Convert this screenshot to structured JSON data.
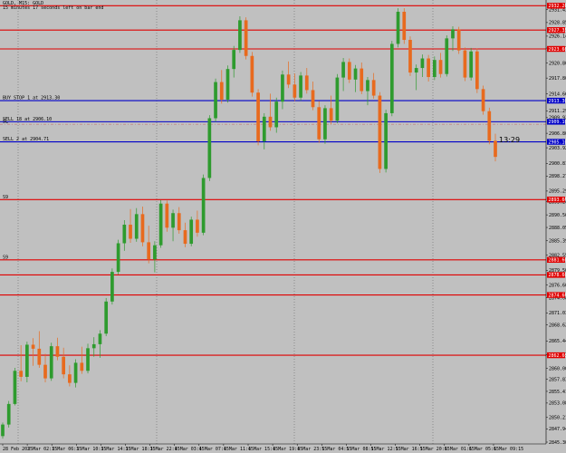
{
  "header": {
    "symbol_line": "GOLD, M15: GOLD",
    "info_line": "15 minutes 17 seconds left on bar end"
  },
  "timer": "13:29",
  "chart_data": {
    "type": "candlestick",
    "symbol": "GOLD",
    "timeframe": "M15",
    "ylim": [
      2845.3,
      2932.8
    ],
    "price_ticks": [
      "2931.43",
      "2928.85",
      "2926.14",
      "2923.77",
      "2920.80",
      "2917.80",
      "2914.66",
      "2911.29",
      "2909.92",
      "2906.80",
      "2903.92",
      "2900.81",
      "2898.27",
      "2895.29",
      "2893.20",
      "2890.56",
      "2888.05",
      "2885.39",
      "2882.55",
      "2879.50",
      "2876.60",
      "2874.08",
      "2871.03",
      "2868.62",
      "2865.44",
      "2862.73",
      "2860.00",
      "2857.83",
      "2855.41",
      "2853.08",
      "2850.21",
      "2847.94",
      "2845.30"
    ],
    "time_ticks": [
      "28 Feb 2025",
      "3 Mar 02:15",
      "3 Mar 06:15",
      "3 Mar 10:15",
      "3 Mar 14:15",
      "3 Mar 18:15",
      "3 Mar 22:15",
      "4 Mar 03:15",
      "4 Mar 07:15",
      "4 Mar 11:15",
      "4 Mar 15:15",
      "4 Mar 19:15",
      "4 Mar 23:15",
      "5 Mar 04:15",
      "5 Mar 08:15",
      "5 Mar 12:15",
      "5 Mar 16:15",
      "5 Mar 20:15",
      "6 Mar 01:15",
      "6 Mar 05:15",
      "6 Mar 09:15"
    ],
    "levels": [
      {
        "price": 2932.2,
        "kind": "red",
        "axis_label": "2932.20",
        "chart_label": ""
      },
      {
        "price": 2927.35,
        "kind": "red",
        "axis_label": "2927.35",
        "chart_label": ""
      },
      {
        "price": 2923.6,
        "kind": "red",
        "axis_label": "2923.60",
        "chart_label": ""
      },
      {
        "price": 2913.3,
        "kind": "blue",
        "axis_label": "2913.30",
        "chart_label": "BUY STOP 1 at 2913.30"
      },
      {
        "price": 2909.1,
        "kind": "blue",
        "axis_label": "2909.10",
        "chart_label": "SELL 18 at 2906.10"
      },
      {
        "price": 2908.6,
        "kind": "dash",
        "axis_label": "",
        "chart_label": "SL"
      },
      {
        "price": 2905.1,
        "kind": "blue",
        "axis_label": "2905.10",
        "chart_label": "SELL 2 at 2904.71"
      },
      {
        "price": 2893.6,
        "kind": "red",
        "axis_label": "2893.60",
        "chart_label": "S9"
      },
      {
        "price": 2881.6,
        "kind": "red",
        "axis_label": "2881.60",
        "chart_label": "S9"
      },
      {
        "price": 2878.6,
        "kind": "red",
        "axis_label": "2878.60",
        "chart_label": ""
      },
      {
        "price": 2874.6,
        "kind": "red",
        "axis_label": "2874.60",
        "chart_label": ""
      },
      {
        "price": 2862.6,
        "kind": "red",
        "axis_label": "2862.60",
        "chart_label": ""
      }
    ],
    "series": [
      {
        "name": "GOLD M15",
        "ohlc": [
          [
            2846.5,
            2849.2,
            2846.0,
            2848.8
          ],
          [
            2848.8,
            2853.5,
            2848.2,
            2852.9
          ],
          [
            2852.9,
            2860.1,
            2852.6,
            2859.5
          ],
          [
            2859.5,
            2864.6,
            2857.4,
            2858.3
          ],
          [
            2858.3,
            2865.3,
            2857.2,
            2864.7
          ],
          [
            2864.7,
            2866.0,
            2860.5,
            2863.9
          ],
          [
            2863.9,
            2867.4,
            2860.1,
            2860.7
          ],
          [
            2860.7,
            2862.9,
            2857.2,
            2858.0
          ],
          [
            2858.0,
            2865.1,
            2857.5,
            2864.4
          ],
          [
            2864.4,
            2866.1,
            2861.6,
            2862.3
          ],
          [
            2862.3,
            2864.1,
            2858.0,
            2858.8
          ],
          [
            2858.8,
            2860.6,
            2856.4,
            2857.1
          ],
          [
            2857.1,
            2861.8,
            2856.2,
            2861.1
          ],
          [
            2861.1,
            2864.3,
            2858.9,
            2859.5
          ],
          [
            2859.5,
            2864.9,
            2859.0,
            2864.0
          ],
          [
            2864.0,
            2866.2,
            2862.3,
            2864.8
          ],
          [
            2864.8,
            2867.6,
            2862.1,
            2866.9
          ],
          [
            2866.9,
            2874.0,
            2866.4,
            2873.3
          ],
          [
            2873.3,
            2879.9,
            2872.7,
            2879.2
          ],
          [
            2879.2,
            2885.6,
            2878.7,
            2884.9
          ],
          [
            2884.9,
            2889.5,
            2883.4,
            2888.6
          ],
          [
            2888.6,
            2891.7,
            2885.0,
            2885.8
          ],
          [
            2885.8,
            2891.9,
            2885.2,
            2890.7
          ],
          [
            2890.7,
            2892.2,
            2884.3,
            2885.1
          ],
          [
            2885.1,
            2888.4,
            2880.9,
            2881.7
          ],
          [
            2881.7,
            2885.3,
            2879.1,
            2884.5
          ],
          [
            2884.5,
            2893.5,
            2884.0,
            2892.8
          ],
          [
            2892.8,
            2893.4,
            2887.2,
            2888.0
          ],
          [
            2888.0,
            2891.6,
            2885.3,
            2890.9
          ],
          [
            2890.9,
            2892.1,
            2886.8,
            2887.5
          ],
          [
            2887.5,
            2889.0,
            2884.1,
            2884.8
          ],
          [
            2884.8,
            2890.2,
            2884.3,
            2889.6
          ],
          [
            2889.6,
            2891.4,
            2886.2,
            2887.0
          ],
          [
            2887.0,
            2898.6,
            2886.5,
            2897.9
          ],
          [
            2897.9,
            2910.4,
            2897.3,
            2909.8
          ],
          [
            2909.8,
            2917.7,
            2909.1,
            2917.0
          ],
          [
            2917.0,
            2919.4,
            2912.7,
            2913.5
          ],
          [
            2913.5,
            2920.3,
            2912.9,
            2919.6
          ],
          [
            2919.6,
            2924.2,
            2917.9,
            2923.4
          ],
          [
            2923.4,
            2930.1,
            2922.8,
            2929.3
          ],
          [
            2929.3,
            2929.9,
            2921.5,
            2922.2
          ],
          [
            2922.2,
            2923.0,
            2914.1,
            2914.9
          ],
          [
            2914.9,
            2915.6,
            2904.4,
            2905.2
          ],
          [
            2905.2,
            2910.8,
            2903.6,
            2910.1
          ],
          [
            2910.1,
            2914.7,
            2907.3,
            2908.0
          ],
          [
            2908.0,
            2913.9,
            2906.9,
            2913.1
          ],
          [
            2913.1,
            2919.3,
            2911.6,
            2918.5
          ],
          [
            2918.5,
            2921.1,
            2915.8,
            2916.5
          ],
          [
            2916.5,
            2918.7,
            2913.2,
            2913.9
          ],
          [
            2913.9,
            2919.0,
            2913.3,
            2918.3
          ],
          [
            2918.3,
            2919.8,
            2914.7,
            2915.4
          ],
          [
            2915.4,
            2917.1,
            2911.4,
            2912.0
          ],
          [
            2912.0,
            2913.2,
            2904.9,
            2905.6
          ],
          [
            2905.6,
            2912.4,
            2904.7,
            2911.8
          ],
          [
            2911.8,
            2914.3,
            2908.6,
            2909.3
          ],
          [
            2909.3,
            2918.6,
            2908.8,
            2917.9
          ],
          [
            2917.9,
            2921.8,
            2915.2,
            2921.0
          ],
          [
            2921.0,
            2921.7,
            2916.8,
            2917.5
          ],
          [
            2917.5,
            2920.4,
            2915.0,
            2919.7
          ],
          [
            2919.7,
            2920.9,
            2914.6,
            2915.2
          ],
          [
            2915.2,
            2918.0,
            2912.4,
            2917.4
          ],
          [
            2917.4,
            2918.8,
            2913.7,
            2914.3
          ],
          [
            2914.3,
            2915.0,
            2898.9,
            2899.7
          ],
          [
            2899.7,
            2911.5,
            2899.0,
            2910.8
          ],
          [
            2910.8,
            2925.2,
            2910.2,
            2924.6
          ],
          [
            2924.6,
            2931.7,
            2923.9,
            2931.0
          ],
          [
            2931.0,
            2931.7,
            2924.6,
            2925.4
          ],
          [
            2925.4,
            2926.1,
            2918.2,
            2918.9
          ],
          [
            2918.9,
            2920.5,
            2915.4,
            2919.8
          ],
          [
            2919.8,
            2922.5,
            2918.0,
            2921.7
          ],
          [
            2921.7,
            2922.4,
            2917.1,
            2918.0
          ],
          [
            2918.0,
            2922.1,
            2917.4,
            2921.4
          ],
          [
            2921.4,
            2922.8,
            2917.9,
            2918.6
          ],
          [
            2918.6,
            2926.3,
            2918.1,
            2925.7
          ],
          [
            2925.7,
            2928.1,
            2923.2,
            2927.5
          ],
          [
            2927.5,
            2928.0,
            2922.6,
            2923.3
          ],
          [
            2923.3,
            2923.9,
            2917.2,
            2917.9
          ],
          [
            2917.9,
            2923.8,
            2917.3,
            2923.1
          ],
          [
            2923.1,
            2923.7,
            2914.8,
            2915.6
          ],
          [
            2915.6,
            2916.3,
            2910.5,
            2911.2
          ],
          [
            2911.2,
            2911.9,
            2904.6,
            2905.3
          ],
          [
            2905.3,
            2906.7,
            2901.2,
            2902.1
          ]
        ]
      }
    ]
  }
}
